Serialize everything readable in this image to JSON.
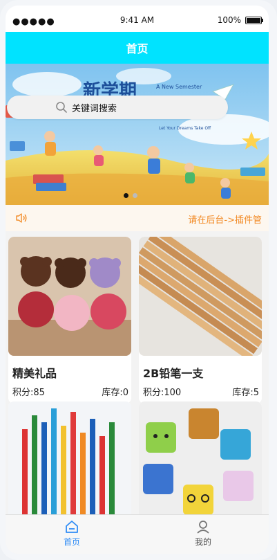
{
  "status_bar": {
    "signal": "●●●●●",
    "time": "9:41 AM",
    "battery": "100%"
  },
  "navbar": {
    "title": "首页"
  },
  "banner": {
    "headline": "新学期",
    "subtitle_en": "A New Semester",
    "subtitle_line": "Let Your Dreams Take Off",
    "dots": 2,
    "active_dot": 0
  },
  "search": {
    "placeholder": "关键词搜索"
  },
  "notice": {
    "text": "请在后台->插件管"
  },
  "products": [
    {
      "name": "精美礼品",
      "points_label": "积分:85",
      "stock_label": "库存:0",
      "image": "teddy-bears"
    },
    {
      "name": "2B铅笔一支",
      "points_label": "积分:100",
      "stock_label": "库存:5",
      "image": "pencils"
    },
    {
      "name": "",
      "points_label": "",
      "stock_label": "",
      "image": "colored-pencils"
    },
    {
      "name": "",
      "points_label": "",
      "stock_label": "",
      "image": "erasers"
    }
  ],
  "tabbar": {
    "items": [
      {
        "label": "首页",
        "icon": "home-icon",
        "active": true
      },
      {
        "label": "我的",
        "icon": "user-icon",
        "active": false
      }
    ]
  },
  "colors": {
    "navbar": "#00e3ff",
    "notice_text": "#f28b27",
    "tab_active": "#2f8cf5"
  }
}
